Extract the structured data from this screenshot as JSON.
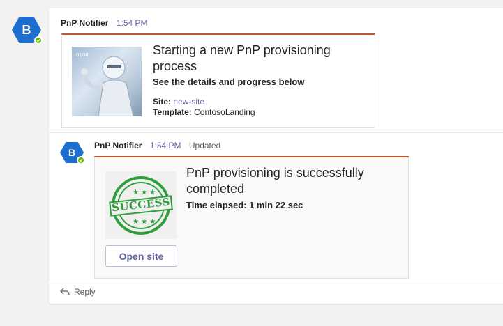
{
  "messages": [
    {
      "avatar_letter": "B",
      "author": "PnP Notifier",
      "time": "1:54 PM",
      "card": {
        "title": "Starting a new PnP provisioning process",
        "subtitle": "See the details and progress below",
        "facts": [
          {
            "key": "Site:",
            "value": "new-site"
          },
          {
            "key": "Template:",
            "value": "ContosoLanding"
          }
        ]
      }
    },
    {
      "avatar_letter": "B",
      "author": "PnP Notifier",
      "time": "1:54 PM",
      "status": "Updated",
      "card": {
        "title": "PnP provisioning is successfully completed",
        "subtitle": "Time elapsed: 1 min 22 sec",
        "image_text": "SUCCESS",
        "button_label": "Open site"
      }
    }
  ],
  "reply": {
    "label": "Reply"
  },
  "colors": {
    "accent": "#6264a7",
    "card_top": "#c4562d",
    "avatar": "#1d6fcf",
    "presence": "#6bb700",
    "stamp": "#2f9e3a"
  }
}
